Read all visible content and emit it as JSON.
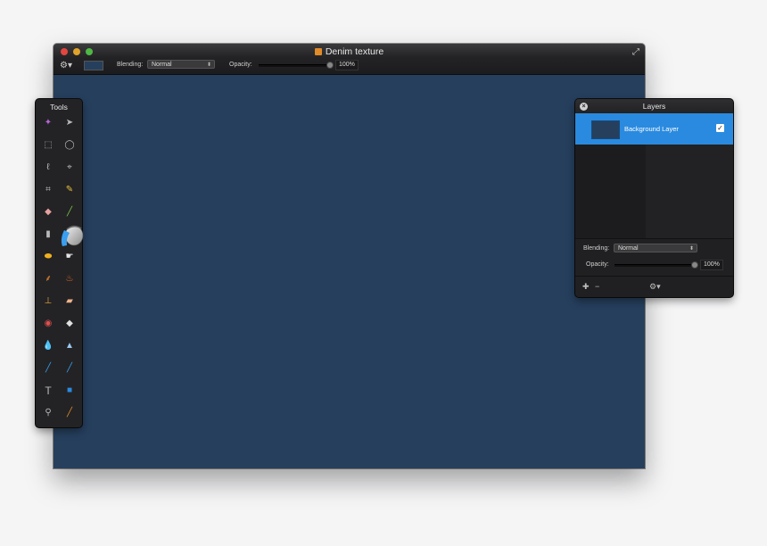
{
  "window": {
    "title": "Denim texture",
    "canvas_color": "#263f5d",
    "icons": {
      "document": "document-icon",
      "fullscreen": "fullscreen-arrows-icon",
      "gear": "gear-icon"
    }
  },
  "toolbar": {
    "blending_label": "Blending:",
    "blending_value": "Normal",
    "opacity_label": "Opacity:",
    "opacity_value": "100%",
    "opacity_fraction": 1.0
  },
  "tools": {
    "title": "Tools",
    "items": [
      "magic-wand-icon",
      "arrow-select-icon",
      "rect-marquee-icon",
      "ellipse-marquee-icon",
      "lasso-icon",
      "polygon-lasso-icon",
      "crop-icon",
      "pencil-icon",
      "eraser-icon",
      "brush-icon",
      "gradient-icon",
      "paint-bucket-icon",
      "sponge-icon",
      "smudge-icon",
      "broom-icon",
      "burn-icon",
      "stamp-icon",
      "bandage-icon",
      "red-eye-icon",
      "clone-eraser-icon",
      "blur-icon",
      "sharpen-icon",
      "pen-icon",
      "pen-add-icon",
      "text-icon",
      "shape-icon",
      "zoom-icon",
      "eyedropper-icon"
    ]
  },
  "layers": {
    "title": "Layers",
    "layer_name": "Background Layer",
    "blending_label": "Blending:",
    "blending_value": "Normal",
    "opacity_label": "Opacity:",
    "opacity_value": "100%",
    "opacity_fraction": 1.0,
    "accent": "#2a8adf"
  }
}
